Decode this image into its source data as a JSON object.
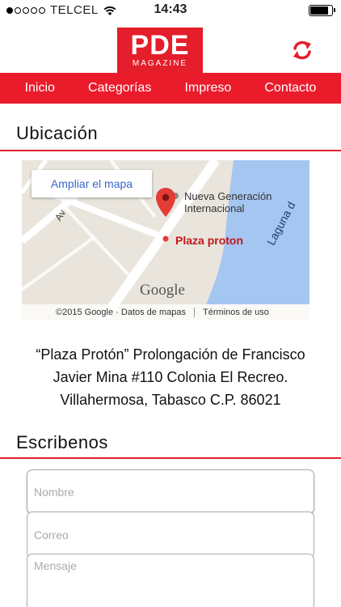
{
  "status_bar": {
    "carrier": "TELCEL",
    "time": "14:43",
    "signal_bars_filled": 1,
    "signal_bars_total": 5,
    "battery_level": 0.85
  },
  "header": {
    "logo_main": "PDE",
    "logo_sub": "MAGAZINE",
    "refresh_icon": "refresh-icon",
    "brand_color": "#e41e2b"
  },
  "nav": {
    "items": [
      {
        "label": "Inicio"
      },
      {
        "label": "Categorías"
      },
      {
        "label": "Impreso"
      },
      {
        "label": "Contacto"
      }
    ]
  },
  "location": {
    "title": "Ubicación",
    "map": {
      "enlarge_button": "Ampliar el mapa",
      "place_label": "Nueva Generación Internacional",
      "place_label_line1": "Nueva Generación",
      "place_label_line2": "Internacional",
      "pin_label": "Plaza proton",
      "lagoon_label": "Laguna d",
      "avenue_label": "Av",
      "google_logo": "Google",
      "copyright": "©2015 Google · Datos de mapas",
      "terms": "Términos de uso"
    },
    "address_line1": "“Plaza Protón” Prolongación de Francisco",
    "address_line2": "Javier Mina #110 Colonia El Recreo.",
    "address_line3": "Villahermosa, Tabasco C.P. 86021"
  },
  "contact_form": {
    "title": "Escribenos",
    "name_placeholder": "Nombre",
    "email_placeholder": "Correo",
    "message_placeholder": "Mensaje"
  }
}
